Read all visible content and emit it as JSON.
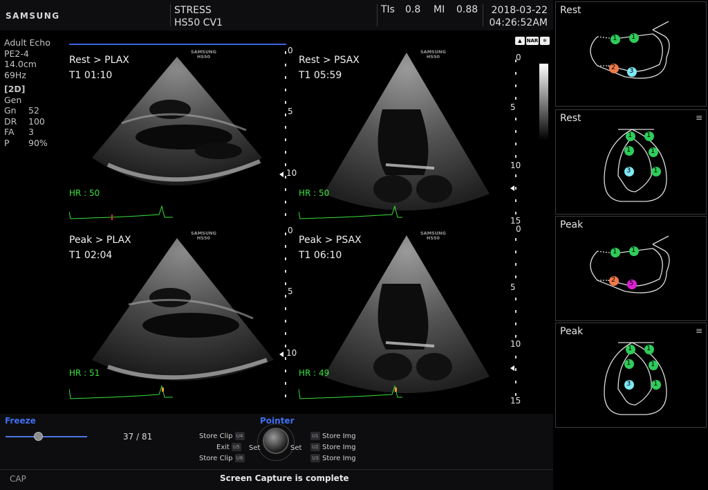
{
  "header": {
    "brand": "SAMSUNG",
    "exam_line1": "STRESS",
    "exam_line2": "HS50 CV1",
    "tis_label": "TIs",
    "tis_value": "0.8",
    "mi_label": "MI",
    "mi_value": "0.88",
    "date": "2018-03-22",
    "time": "04:26:52AM"
  },
  "params": {
    "app": "Adult Echo",
    "probe": "PE2-4",
    "depth": "14.0cm",
    "frame_rate": "69Hz",
    "mode": "[2D]",
    "preset": "Gen",
    "rows": [
      {
        "k": "Gn",
        "v": "52"
      },
      {
        "k": "DR",
        "v": "100"
      },
      {
        "k": "FA",
        "v": "3"
      },
      {
        "k": "P",
        "v": "90%"
      }
    ]
  },
  "quadrants": [
    {
      "title": "Rest > PLAX",
      "time": "T1 01:10",
      "hr": "HR : 50",
      "sam1": "SAMSUNG",
      "sam2": "HS50"
    },
    {
      "title": "Rest > PSAX",
      "time": "T1 05:59",
      "hr": "HR : 50",
      "sam1": "SAMSUNG",
      "sam2": "HS50"
    },
    {
      "title": "Peak > PLAX",
      "time": "T1 02:04",
      "hr": "HR : 51",
      "sam1": "SAMSUNG",
      "sam2": "HS50"
    },
    {
      "title": "Peak > PSAX",
      "time": "T1 06:10",
      "hr": "HR : 49",
      "sam1": "SAMSUNG",
      "sam2": "HS50"
    }
  ],
  "depth_scale_a": [
    "0",
    "5",
    "10"
  ],
  "depth_scale_b": [
    "0",
    "5",
    "10",
    "15"
  ],
  "status_icons": [
    "NAR",
    "❄",
    "▲"
  ],
  "right_panels": [
    {
      "title": "Rest",
      "scores": [
        "1",
        "1",
        "2",
        "3"
      ]
    },
    {
      "title": "Rest",
      "menu": "≡",
      "scores": [
        "1",
        "1",
        "1",
        "1",
        "3",
        "1"
      ]
    },
    {
      "title": "Peak",
      "scores": [
        "1",
        "1",
        "2",
        "5"
      ]
    },
    {
      "title": "Peak",
      "menu": "≡",
      "scores": [
        "1",
        "1",
        "1",
        "1",
        "3",
        "1"
      ]
    }
  ],
  "bottom": {
    "freeze_label": "Freeze",
    "frame_count": "37 / 81",
    "slider_value": 0.4,
    "pointer_label": "Pointer",
    "left_ctrls": [
      {
        "label": "Store Clip",
        "key": "U4"
      },
      {
        "label": "Exit",
        "key": "U5"
      },
      {
        "label": "Store Clip",
        "key": "U6"
      }
    ],
    "right_ctrls": [
      {
        "label": "Store Img",
        "key": "U1"
      },
      {
        "label": "Store Img",
        "key": "U2"
      },
      {
        "label": "Store Img",
        "key": "U3"
      }
    ],
    "set_left": "Set",
    "set_right": "Set",
    "cap_label": "CAP",
    "status_message": "Screen Capture is complete"
  },
  "colors": {
    "accent_blue": "#3f6ff2",
    "hr_green": "#39e43b",
    "score_green": "#2ecc5a",
    "score_orange": "#f07a4a",
    "score_cyan": "#7fe8f5",
    "score_magenta": "#e01fd4"
  }
}
